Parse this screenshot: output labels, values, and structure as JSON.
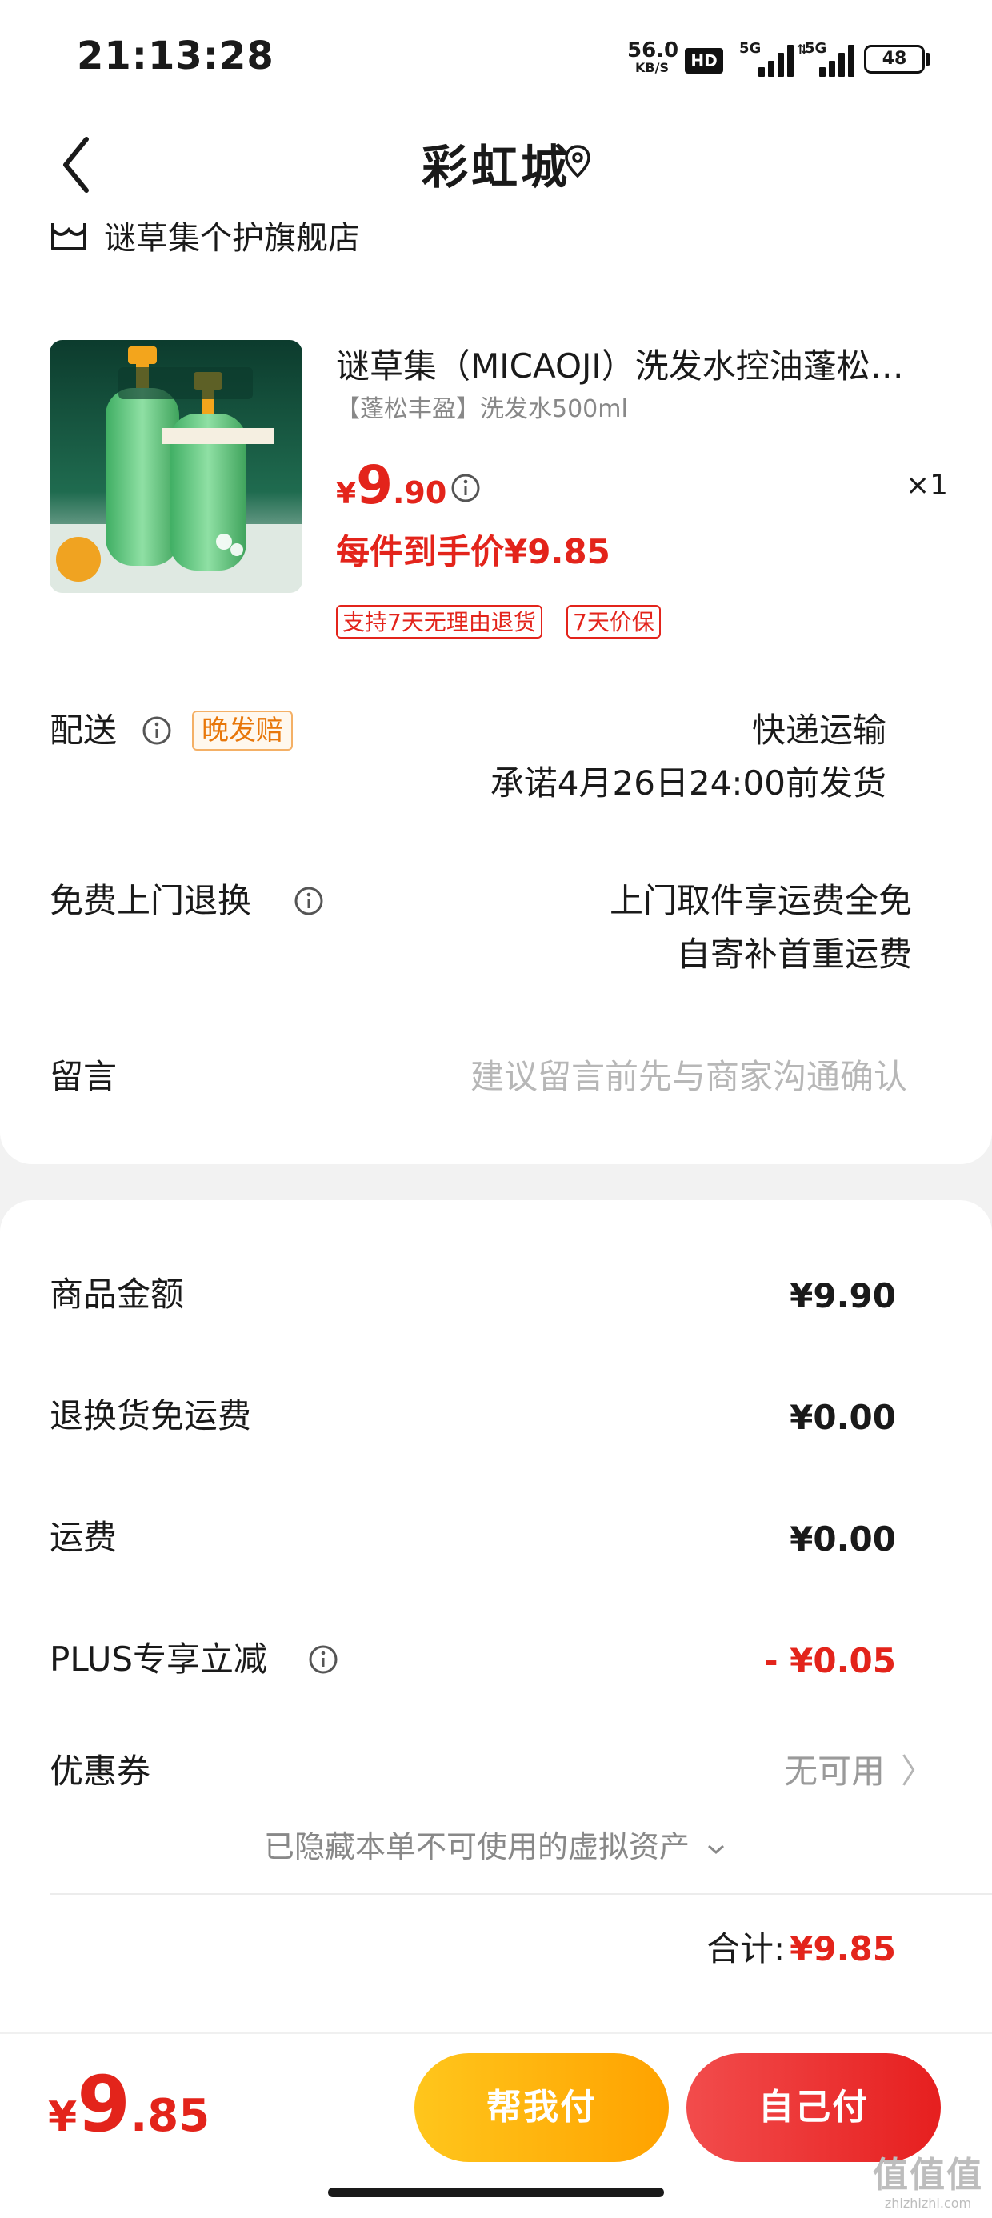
{
  "status_bar": {
    "time": "21:13:28",
    "net_speed": "56.0",
    "net_unit": "KB/S",
    "hd_label": "HD",
    "signal1_label": "5G",
    "signal2_label": "5G",
    "battery": "48"
  },
  "nav": {
    "title": "彩虹城"
  },
  "store": {
    "name": "谜草集个护旗舰店"
  },
  "product": {
    "title": "谜草集（MICAOJI）洗发水控油蓬松丰盈洗发水",
    "spec": "【蓬松丰盈】洗发水500ml",
    "price_symbol": "¥",
    "price_int": "9",
    "price_dec": ".90",
    "quantity": "×1",
    "final_price": "每件到手价¥9.85",
    "tags": [
      "支持7天无理由退货",
      "7天价保"
    ]
  },
  "delivery": {
    "label": "配送",
    "badge": "晚发赔",
    "method": "快递运输",
    "promise": "承诺4月26日24:00前发货"
  },
  "return_service": {
    "label": "免费上门退换",
    "line1": "上门取件享运费全免",
    "line2": "自寄补首重运费"
  },
  "message": {
    "label": "留言",
    "placeholder": "建议留言前先与商家沟通确认"
  },
  "summary": {
    "items": [
      {
        "label": "商品金额",
        "value": "¥9.90"
      },
      {
        "label": "退换货免运费",
        "value": "¥0.00"
      },
      {
        "label": "运费",
        "value": "¥0.00"
      },
      {
        "label": "PLUS专享立减",
        "value": "- ¥0.05"
      },
      {
        "label": "优惠券",
        "value": "无可用"
      }
    ],
    "hidden_assets": "已隐藏本单不可使用的虚拟资产",
    "total_label": "合计:",
    "total_value": "¥9.85"
  },
  "bottom": {
    "price_symbol": "¥",
    "price_int": "9",
    "price_dec": ".85",
    "help_pay": "帮我付",
    "self_pay": "自己付"
  },
  "watermark": {
    "text": "值值值",
    "url": "zhizhizhi.com"
  },
  "colors": {
    "accent_red": "#e3241b",
    "help_button": "#ffb30f",
    "self_button": "#ec3535"
  }
}
